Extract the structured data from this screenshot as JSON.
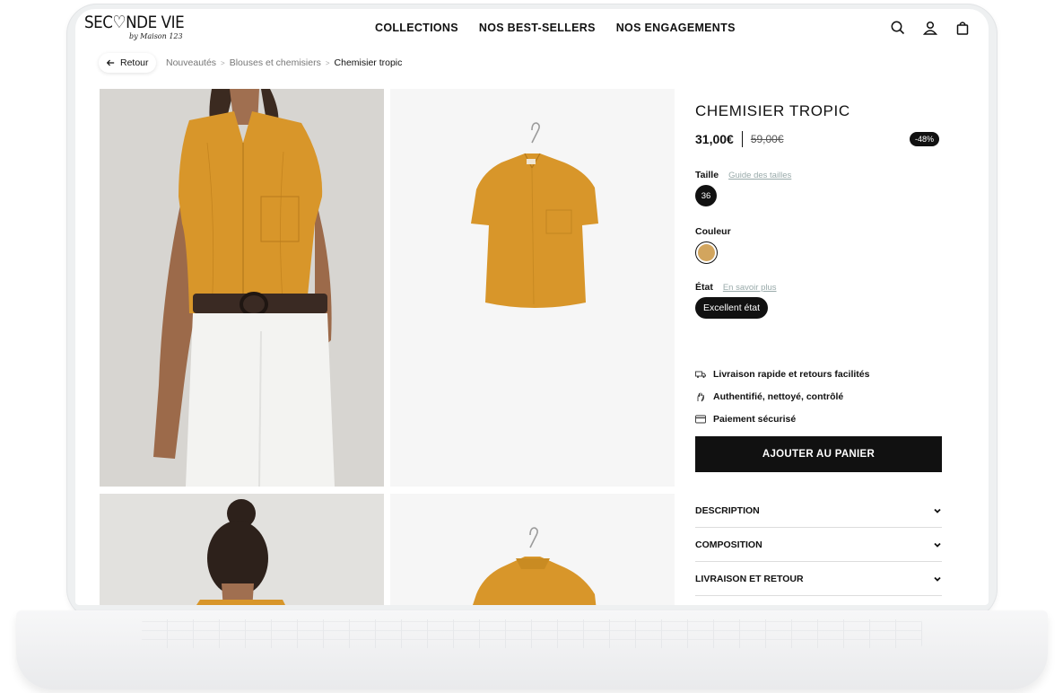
{
  "brand": {
    "logo_text": "SEC♡NDE VIE",
    "logo_sub": "by Maison 123",
    "colors": {
      "primary": "#111111",
      "shirt": "#d89a2b",
      "swatch": "#d2a55e"
    }
  },
  "nav": {
    "items": [
      "COLLECTIONS",
      "NOS BEST-SELLERS",
      "NOS ENGAGEMENTS"
    ],
    "icons": [
      "search-icon",
      "user-icon",
      "bag-icon"
    ]
  },
  "breadcrumb": {
    "back_label": "Retour",
    "items": [
      "Nouveautés",
      "Blouses et chemisiers",
      "Chemisier tropic"
    ]
  },
  "product": {
    "title": "CHEMISIER TROPIC",
    "price_current": "31,00€",
    "price_old": "59,00€",
    "discount": "-48%",
    "size_label": "Taille",
    "size_guide": "Guide des tailles",
    "size_value": "36",
    "color_label": "Couleur",
    "state_label": "État",
    "state_more": "En savoir plus",
    "state_value": "Excellent état",
    "features": [
      {
        "icon": "truck-icon",
        "text": "Livraison rapide et retours facilités"
      },
      {
        "icon": "hand-icon",
        "text": "Authentifié, nettoyé, contrôlé"
      },
      {
        "icon": "card-icon",
        "text": "Paiement sécurisé"
      }
    ],
    "cart_button": "AJOUTER AU PANIER",
    "accordions": [
      "DESCRIPTION",
      "COMPOSITION",
      "LIVRAISON ET RETOUR"
    ]
  }
}
